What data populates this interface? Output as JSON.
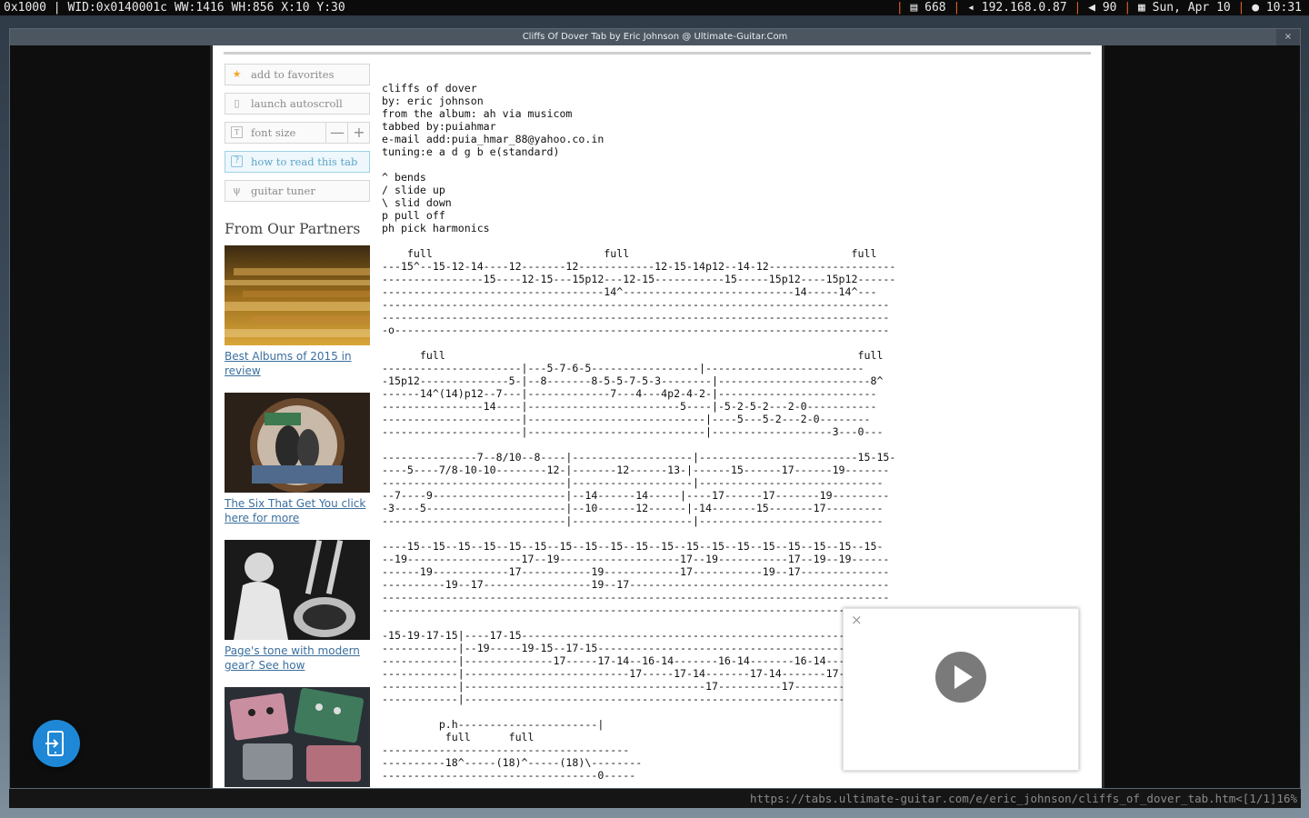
{
  "topbar": {
    "left": "0x1000 | WID:0x0140001c WW:1416 WH:856 X:10 Y:30",
    "items": [
      "668",
      "192.168.0.87",
      "90",
      "Sun, Apr 10",
      "10:31"
    ],
    "icons": [
      "memory-icon",
      "network-icon",
      "volume-icon",
      "calendar-icon",
      "clock-icon"
    ]
  },
  "window": {
    "title": "Cliffs Of Dover Tab by Eric Johnson @ Ultimate-Guitar.Com"
  },
  "sidebar": {
    "buttons": {
      "favorites": "add to favorites",
      "autoscroll": "launch autoscroll",
      "font_size": "font size",
      "font_minus": "—",
      "font_plus": "+",
      "how_to": "how to read this tab",
      "tuner": "guitar tuner"
    },
    "partners_title": "From Our Partners",
    "partners": [
      {
        "caption": "Best Albums of 2015 in review",
        "image": "stacked-cd-cases-photo"
      },
      {
        "caption": "The Six That Get You click here for more",
        "image": "guitar-soundhole-feet-photo"
      },
      {
        "caption": "Page's tone with modern gear? See how",
        "image": "double-neck-guitarist-photo"
      },
      {
        "caption": "",
        "image": "effects-pedals-photo"
      }
    ]
  },
  "tab_text": "cliffs of dover\nby: eric johnson\nfrom the album: ah via musicom\ntabbed by:puiahmar\ne-mail add:puia_hmar_88@yahoo.co.in\ntuning:e a d g b e(standard)\n\n^ bends\n/ slide up\n\\ slid down\np pull off\nph pick harmonics\n\n    full                           full                                   full\n---15^--15-12-14----12-------12------------12-15-14p12--14-12--------------------\n----------------15----12-15---15p12---12-15-----------15-----15p12----15p12------\n-----------------------------------14^---------------------------14-----14^---\n--------------------------------------------------------------------------------\n--------------------------------------------------------------------------------\n-o------------------------------------------------------------------------------\n\n      full                                                                 full\n----------------------|---5-7-6-5-----------------|-------------------------\n-15p12--------------5-|--8-------8-5-5-7-5-3--------|------------------------8^\n------14^(14)p12--7---|-------------7---4---4p2-4-2-|-------------------------\n----------------14----|------------------------5----|-5-2-5-2---2-0-----------\n----------------------|----------------------------|----5---5-2---2-0--------\n----------------------|----------------------------|-------------------3---0---\n\n---------------7--8/10--8----|-------------------|-------------------------15-15-\n----5----7/8-10-10--------12-|-------12------13-|------15------17------19-------\n-----------------------------|-------------------|-----------------------------\n--7----9---------------------|--14------14-----|----17------17-------19---------\n-3----5----------------------|--10------12------|-14-------15-------17---------\n-----------------------------|-------------------|-----------------------------\n\n----15--15--15--15--15--15--15--15--15--15--15--15--15--15--15--15--15--15--15-\n--19------------------17--19-------------------17--19-----------17--19--19------\n------19------------17-----------19------------17-----------19--17--------------\n----------19--17-----------------19--17-----------------------------------------\n--------------------------------------------------------------------------------\n--------------------------------------------------------------------------------\n\n-15-19-17-15|----17-15---------------------------------------------------------\n------------|--19-----19-15--17-15---------------------------------------------\n------------|--------------17-----17-14--16-14-------16-14-------16-14---------\n------------|--------------------------17-----17-14-------17-14-------17-14-----\n------------|--------------------------------------17----------17----------17--\n------------|------------------------------------------------------------------15\n\n         p.h----------------------|\n          full      full\n---------------------------------------\n----------18^-----(18)^-----(18)\\--------\n----------------------------------0-----",
  "video": {
    "state": "paused"
  },
  "urlbar": {
    "url": "https://tabs.ultimate-guitar.com/e/eric_johnson/cliffs_of_dover_tab.htm",
    "position": "<[1/1]",
    "percent": "16%"
  }
}
